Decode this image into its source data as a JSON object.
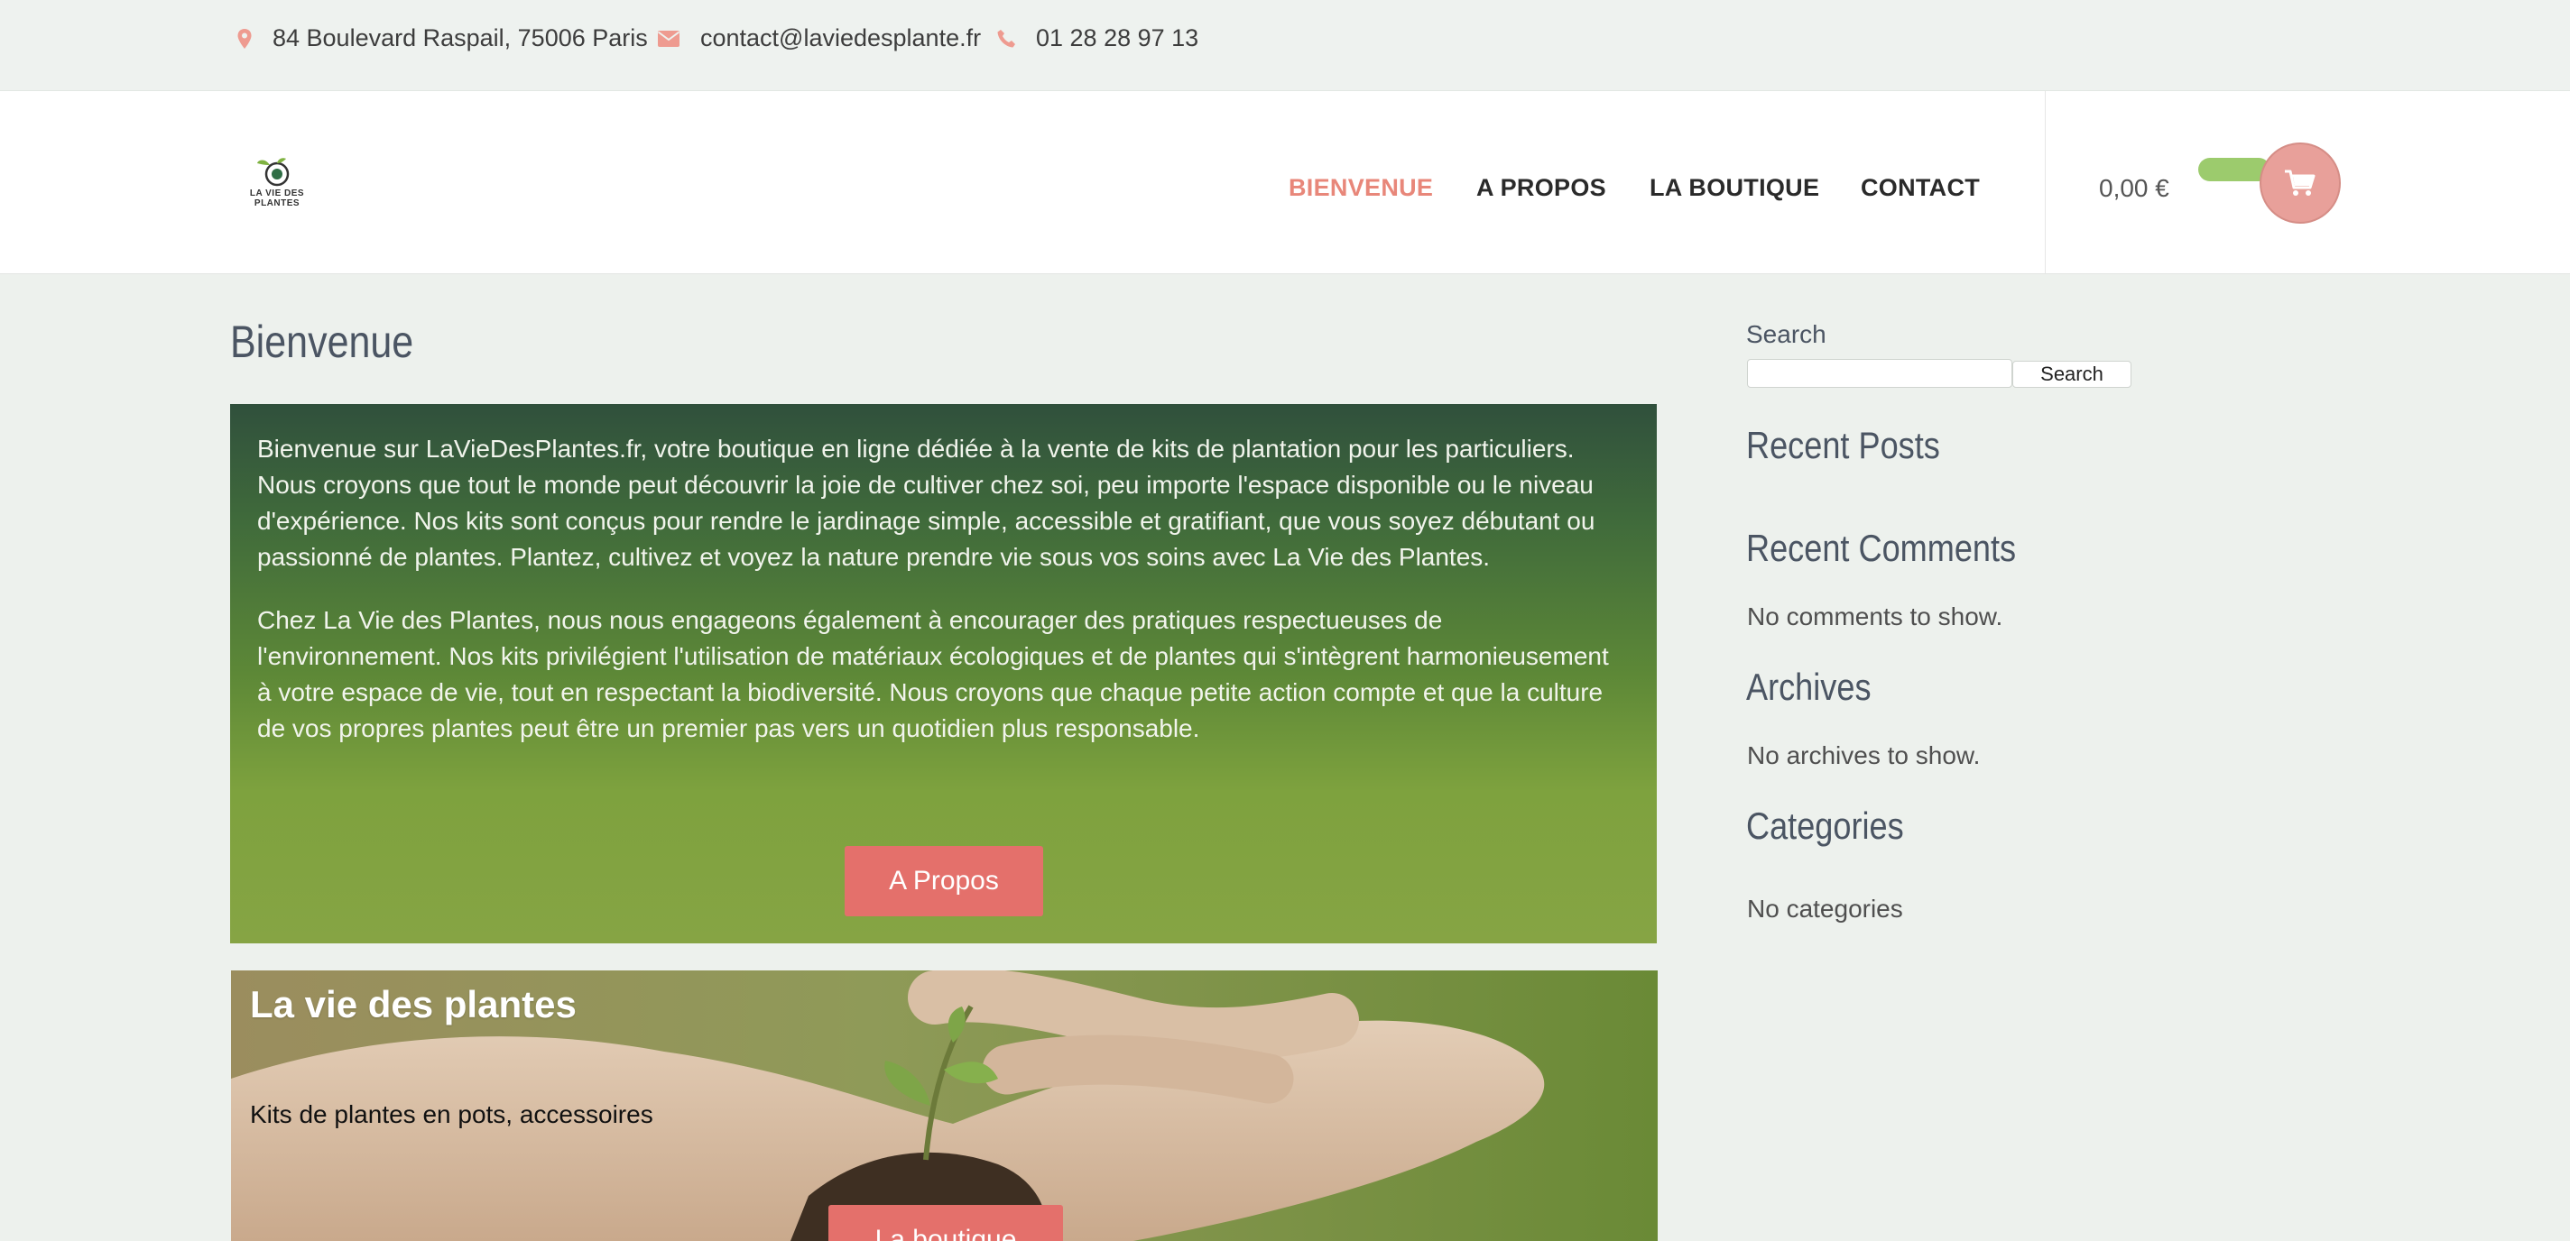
{
  "topbar": {
    "address": "84 Boulevard Raspail, 75006 Paris",
    "email": "contact@laviedesplante.fr",
    "phone": "01 28 28 97 13"
  },
  "header": {
    "logo_text": "LA VIE DES PLANTES",
    "nav": [
      {
        "label": "BIENVENUE",
        "active": true
      },
      {
        "label": "A PROPOS",
        "active": false
      },
      {
        "label": "LA BOUTIQUE",
        "active": false
      },
      {
        "label": "CONTACT",
        "active": false
      }
    ],
    "cart_total": "0,00 €"
  },
  "main": {
    "title": "Bienvenue",
    "hero": {
      "paragraphs": [
        "Bienvenue sur LaVieDesPlantes.fr, votre boutique en ligne dédiée à la vente de kits de plantation pour les particuliers. Nous croyons que tout le monde peut découvrir la joie de cultiver chez soi, peu importe l'espace disponible ou le niveau d'expérience. Nos kits sont conçus pour rendre le jardinage simple, accessible et gratifiant, que vous soyez débutant ou passionné de plantes. Plantez, cultivez et voyez la nature prendre vie sous vos soins avec La Vie des Plantes.",
        "Chez La Vie des Plantes, nous nous engageons également à encourager des pratiques respectueuses de l'environnement. Nos kits privilégient l'utilisation de matériaux écologiques et de plantes qui s'intègrent harmonieusement à votre espace de vie, tout en respectant la biodiversité. Nous croyons que chaque petite action compte et que la culture de vos propres plantes peut être un premier pas vers un quotidien plus responsable."
      ],
      "button_label": "A Propos"
    },
    "banner": {
      "title": "La vie des plantes",
      "subtitle": "Kits de plantes en pots, accessoires",
      "button_label": "La boutique"
    }
  },
  "sidebar": {
    "search_label": "Search",
    "search_placeholder": "",
    "search_button": "Search",
    "widgets": [
      {
        "title": "Recent Posts",
        "text": ""
      },
      {
        "title": "Recent Comments",
        "text": "No comments to show."
      },
      {
        "title": "Archives",
        "text": "No archives to show."
      },
      {
        "title": "Categories",
        "text": "No categories"
      }
    ]
  },
  "colors": {
    "accent": "#e8877a",
    "button": "#e4706b",
    "hero_dark": "#30503c",
    "hero_light": "#86a444"
  },
  "icons": {
    "address": "map-pin-icon",
    "email": "envelope-icon",
    "phone": "phone-icon",
    "cart": "shopping-cart-icon"
  }
}
